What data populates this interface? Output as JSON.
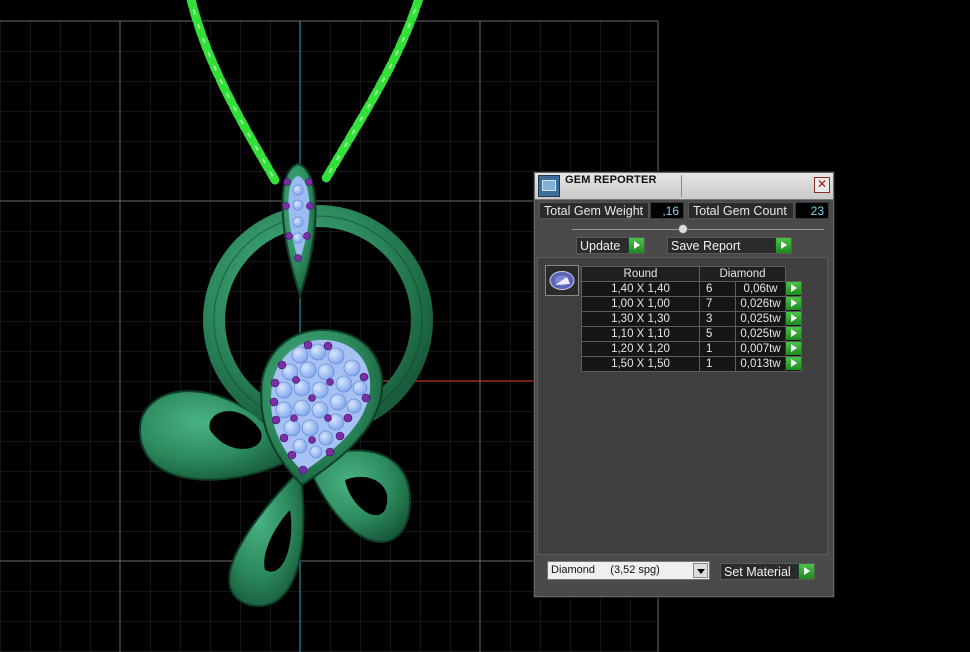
{
  "window": {
    "title": "GEM REPORTER",
    "close_glyph": "✕"
  },
  "stats": {
    "weight_label": "Total Gem Weight",
    "weight_value": ",16",
    "count_label": "Total Gem Count",
    "count_value": "23"
  },
  "buttons": {
    "update": "Update",
    "save_report": "Save Report",
    "set_material": "Set Material"
  },
  "gem_table": {
    "headers": {
      "shape": "Round",
      "material": "Diamond"
    },
    "rows": [
      {
        "size": "1,40 X 1,40",
        "count": "6",
        "weight": "0,06tw"
      },
      {
        "size": "1,00 X 1,00",
        "count": "7",
        "weight": "0,026tw"
      },
      {
        "size": "1,30 X 1,30",
        "count": "3",
        "weight": "0,025tw"
      },
      {
        "size": "1,10 X 1,10",
        "count": "5",
        "weight": "0,025tw"
      },
      {
        "size": "1,20 X 1,20",
        "count": "1",
        "weight": "0,007tw"
      },
      {
        "size": "1,50 X 1,50",
        "count": "1",
        "weight": "0,013tw"
      }
    ]
  },
  "material": {
    "selected": "Diamond     (3,52 spg)"
  },
  "icons": {
    "title": "gem-reporter-icon",
    "close": "close-icon",
    "play": "play-arrow-icon",
    "gem": "round-gem-icon",
    "dropdown": "chevron-down-icon"
  },
  "colors": {
    "chain": "#33e03a",
    "metal": "#2f8f62",
    "stones": "#8fb4f2",
    "accent_stones": "#7a2fa8",
    "value_text": "#7ad8f0",
    "play_button": "#2fa52f"
  }
}
